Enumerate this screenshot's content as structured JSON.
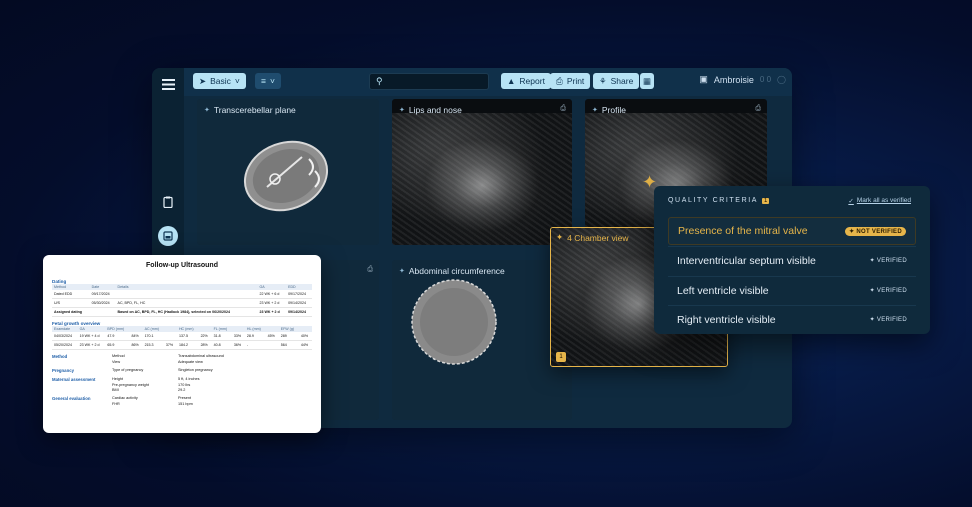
{
  "toolbar": {
    "mode_label": "Basic",
    "mode_icon": "cursor-icon",
    "layout_icon": "grid-icon",
    "search_placeholder": "",
    "report_label": "Report",
    "print_label": "Print",
    "share_label": "Share",
    "user_name": "Ambroisie",
    "user_extra": "0 0"
  },
  "panels": {
    "transcerebellar": "Transcerebellar plane",
    "lips": "Lips and nose",
    "profile": "Profile",
    "abdominal": "Abdominal circumference",
    "chamber": "4 Chamber view",
    "chamber_badge": "1"
  },
  "report": {
    "title": "Follow-up Ultrasound",
    "dating_label": "Dating",
    "dating_headers": [
      "Method",
      "Date",
      "Details",
      "",
      "GA",
      "EDD"
    ],
    "dating_rows": [
      [
        "Dated EDD",
        "09/17/2024",
        "",
        "",
        "22 WK + 6 d",
        "09/17/2024"
      ],
      [
        "U/S",
        "05/30/2024",
        "AC, BPD, FL, HC",
        "",
        "23 WK + 2 d",
        "09/14/2024"
      ],
      [
        "Assigned dating",
        "",
        "Based on AC, BPD, FL, HC (Hadlock 1984), selected on 06/20/2024",
        "",
        "23 WK + 2 d",
        "09/14/2024"
      ]
    ],
    "growth_label": "Fetal growth overview",
    "growth_headers": [
      "Examdate",
      "GA",
      "BPD (mm)",
      "",
      "AC (mm)",
      "",
      "HC (mm)",
      "",
      "FL (mm)",
      "",
      "HL (mm)",
      "",
      "EFW (g)",
      ""
    ],
    "growth_rows": [
      [
        "04/03/2024",
        "19 WK + 4 d",
        "47.9",
        "84%",
        "170.1",
        "",
        "137.5",
        "22%",
        "31.8",
        "33%",
        "28.9",
        "45%",
        "289",
        "40%"
      ],
      [
        "05/20/2024",
        "23 WK + 2 d",
        "65.9",
        "86%",
        "215.3",
        "37%",
        "184.2",
        "28%",
        "40.8",
        "36%",
        "-",
        "",
        "564",
        "44%"
      ]
    ],
    "sections": [
      {
        "label": "Method",
        "keys": [
          "Method",
          "View"
        ],
        "vals": [
          "Transabdominal ultrasound",
          "Adequate view"
        ]
      },
      {
        "label": "Pregnancy",
        "keys": [
          "Type of pregnancy"
        ],
        "vals": [
          "Singleton pregnancy"
        ]
      },
      {
        "label": "Maternal assessment",
        "keys": [
          "Height",
          "Pre-pregnancy weight",
          "BMI"
        ],
        "vals": [
          "5 ft, 4 inches",
          "170 lbs",
          "29.2"
        ]
      },
      {
        "label": "General evaluation",
        "keys": [
          "Cardiac activity",
          "FHR"
        ],
        "vals": [
          "Present",
          "151 bpm"
        ]
      }
    ]
  },
  "quality": {
    "heading": "QUALITY CRITERIA",
    "count": "1",
    "mark_all": "Mark all as verified",
    "items": [
      {
        "label": "Presence of the mitral valve",
        "status": "NOT VERIFIED"
      },
      {
        "label": "Interventricular septum visible",
        "status": "VERIFIED"
      },
      {
        "label": "Left ventricle visible",
        "status": "VERIFIED"
      },
      {
        "label": "Right ventricle visible",
        "status": "VERIFIED"
      }
    ]
  },
  "colors": {
    "accent": "#e6b54a",
    "pill": "#b7e3f5",
    "app_bg": "#0f2a3f"
  }
}
